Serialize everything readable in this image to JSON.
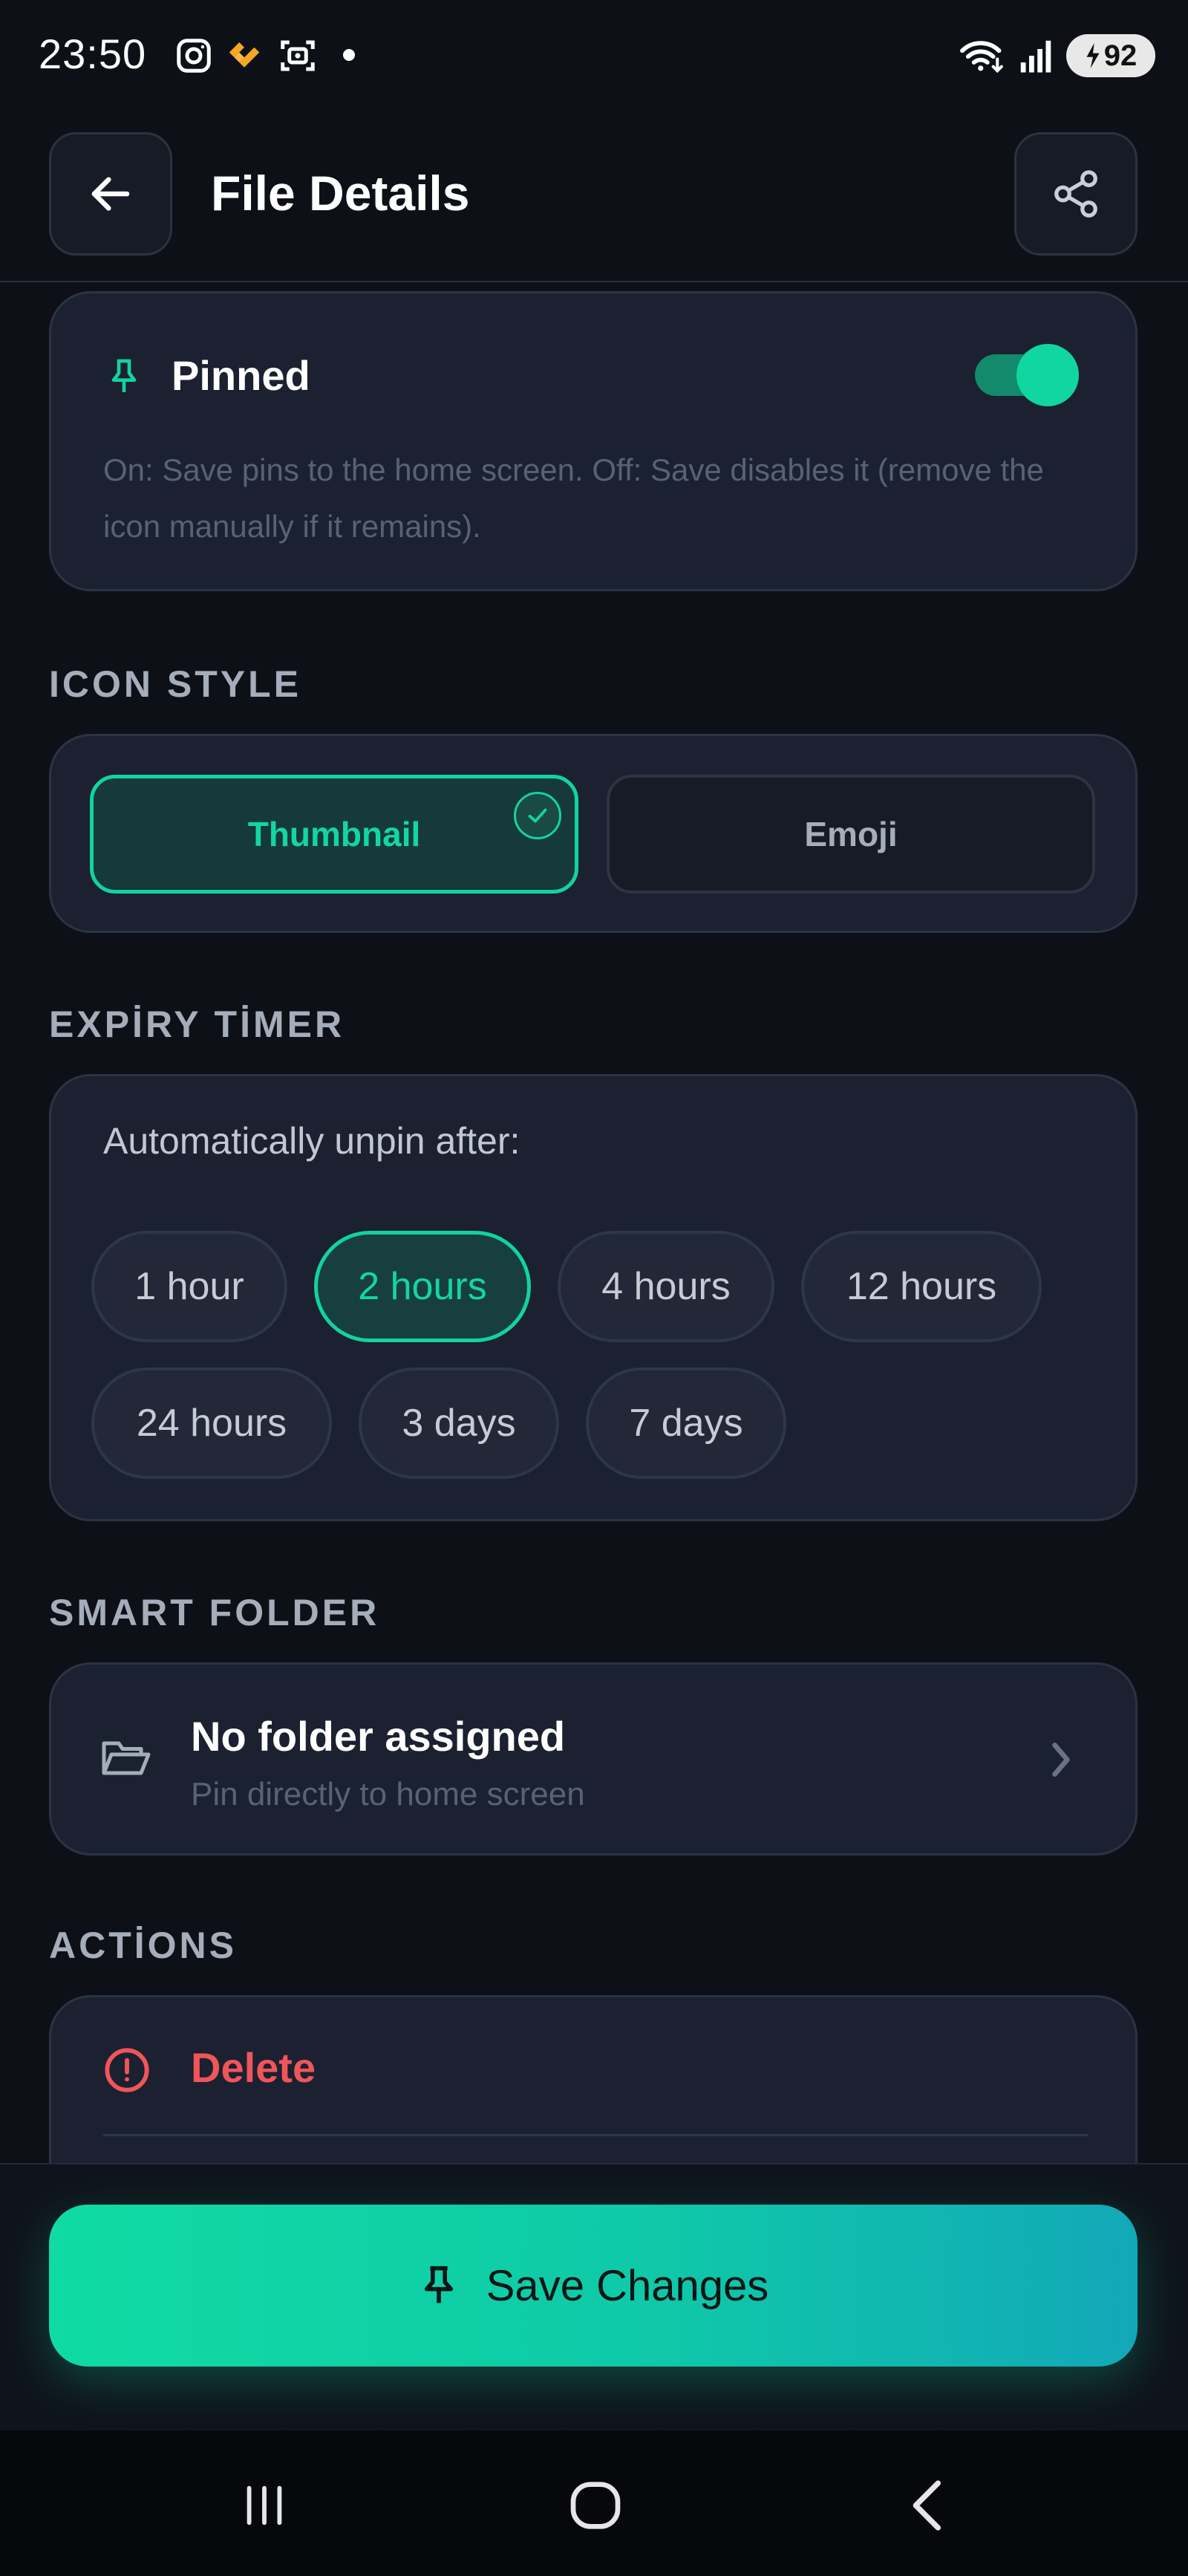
{
  "status_bar": {
    "time": "23:50",
    "icons": [
      "instagram-icon",
      "app-icon",
      "screenshot-icon",
      "wifi-icon",
      "signal-icon"
    ],
    "battery": "92"
  },
  "header": {
    "title": "File Details"
  },
  "pinned": {
    "label": "Pinned",
    "enabled": true,
    "description": "On: Save pins to the home screen. Off: Save disables it (remove the icon manually if it remains).",
    "accent": "#12d3a0"
  },
  "icon_style": {
    "section_label": "ICON STYLE",
    "options": [
      {
        "label": "Thumbnail",
        "selected": true
      },
      {
        "label": "Emoji",
        "selected": false
      }
    ]
  },
  "expiry": {
    "section_label": "EXPİRY TİMER",
    "prompt": "Automatically unpin after:",
    "options": [
      {
        "label": "1 hour",
        "selected": false
      },
      {
        "label": "2 hours",
        "selected": true
      },
      {
        "label": "4 hours",
        "selected": false
      },
      {
        "label": "12 hours",
        "selected": false
      },
      {
        "label": "24 hours",
        "selected": false
      },
      {
        "label": "3 days",
        "selected": false
      },
      {
        "label": "7 days",
        "selected": false
      }
    ]
  },
  "smart_folder": {
    "section_label": "SMART FOLDER",
    "title": "No folder assigned",
    "subtitle": "Pin directly to home screen"
  },
  "actions": {
    "section_label": "ACTİONS",
    "delete_label": "Delete",
    "danger_color": "#f0555a"
  },
  "footer": {
    "save_label": "Save Changes"
  }
}
